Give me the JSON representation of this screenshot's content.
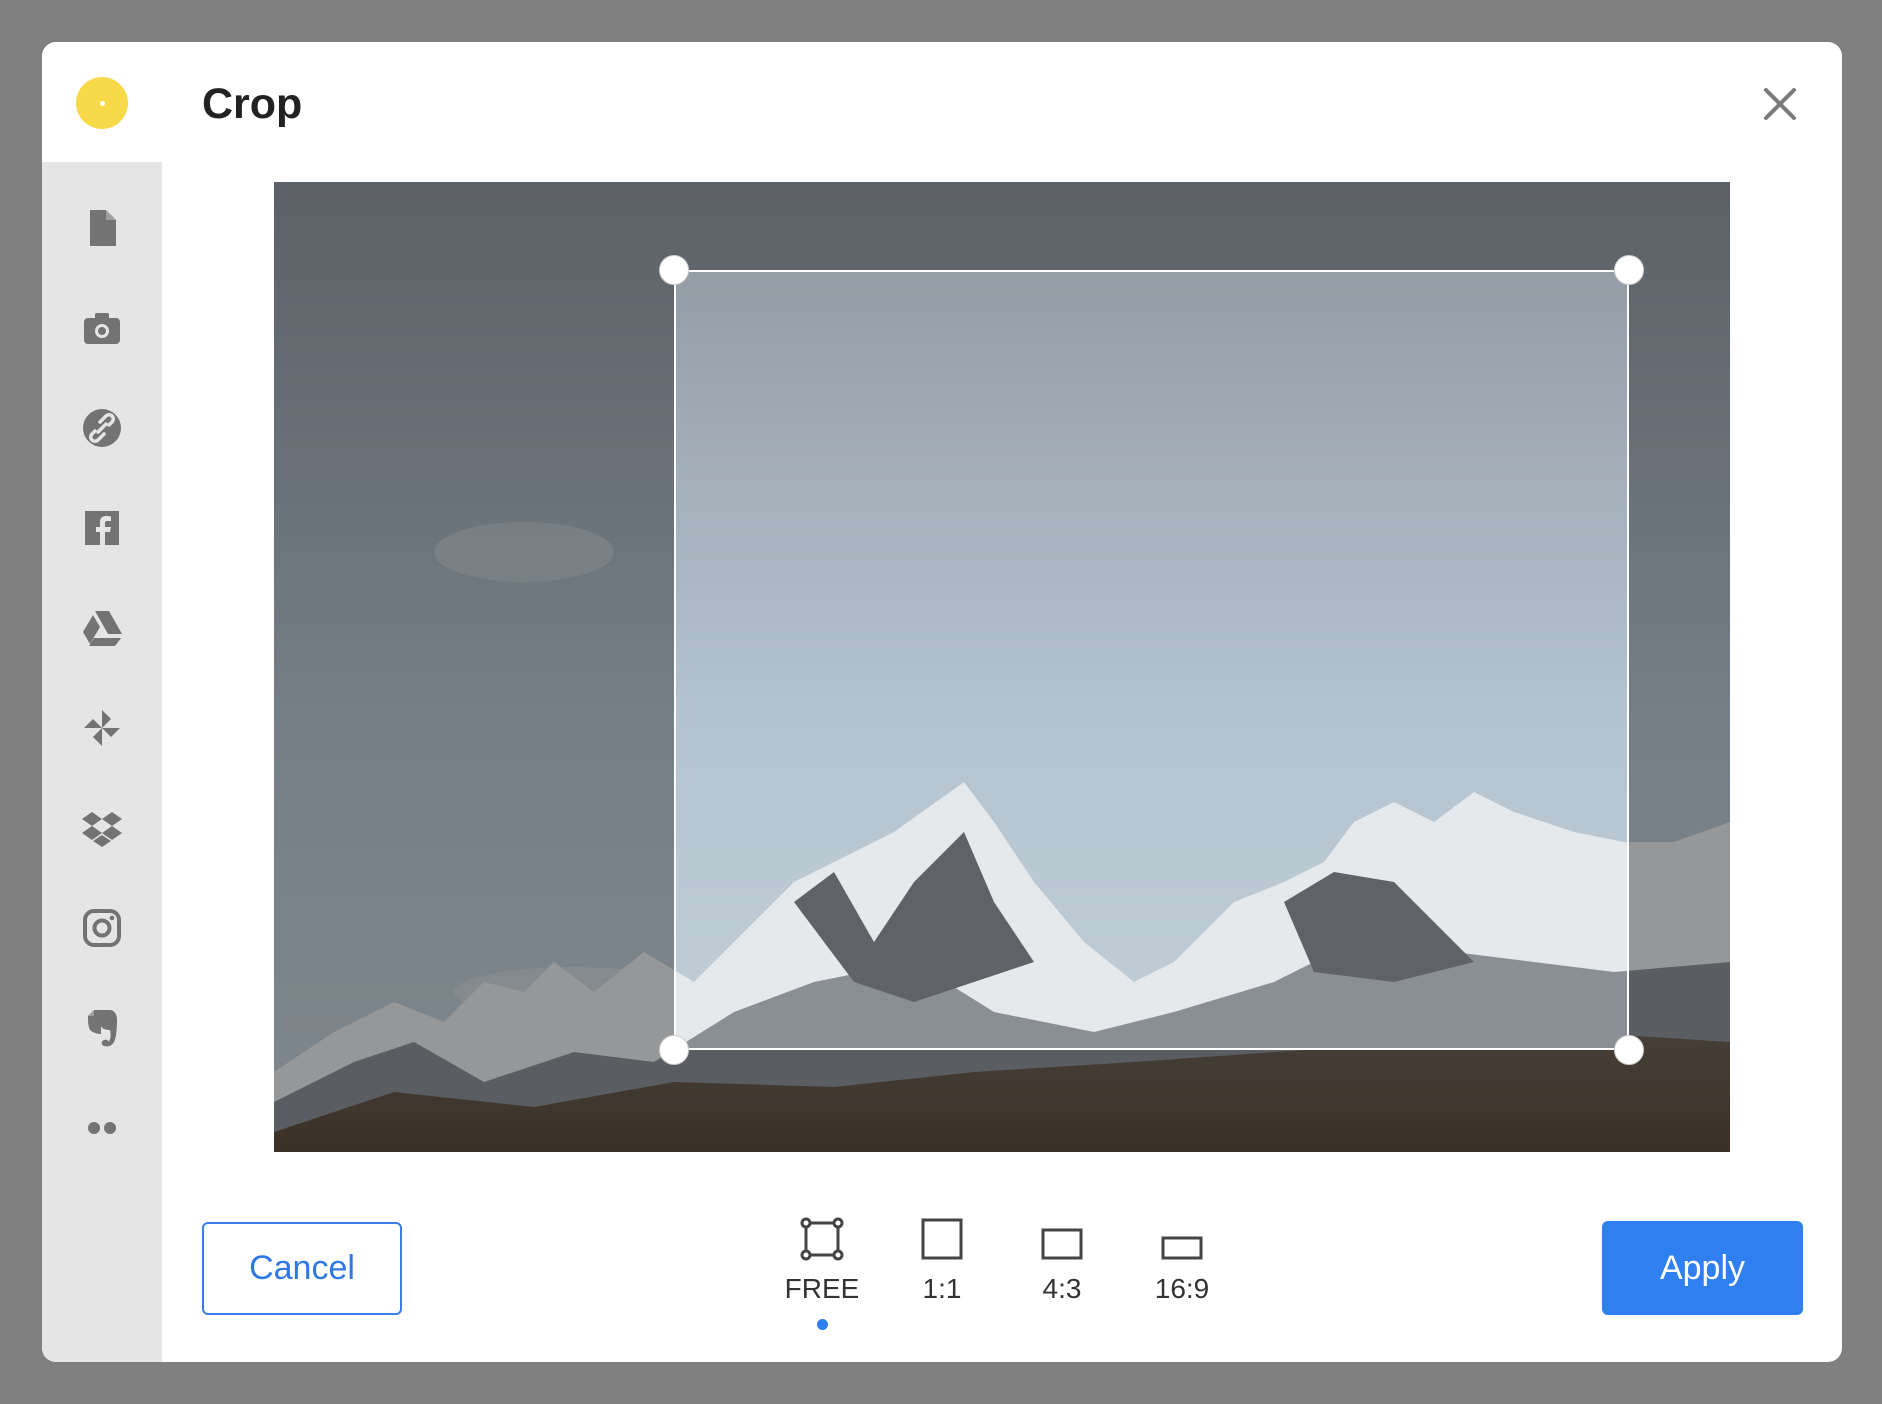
{
  "dialog": {
    "title": "Crop"
  },
  "sidebar": {
    "items": [
      {
        "name": "file-icon"
      },
      {
        "name": "camera-icon"
      },
      {
        "name": "link-icon"
      },
      {
        "name": "facebook-icon"
      },
      {
        "name": "google-drive-icon"
      },
      {
        "name": "google-photos-icon"
      },
      {
        "name": "dropbox-icon"
      },
      {
        "name": "instagram-icon"
      },
      {
        "name": "evernote-icon"
      },
      {
        "name": "more-icon"
      }
    ]
  },
  "ratios": {
    "free": "FREE",
    "square": "1:1",
    "four_three": "4:3",
    "sixteen_nine": "16:9",
    "selected": "FREE"
  },
  "buttons": {
    "cancel": "Cancel",
    "apply": "Apply"
  },
  "colors": {
    "accent": "#2f7ff0",
    "logo": "#f7d94a",
    "sidebar_bg": "#e5e5e5",
    "backdrop": "#808080"
  }
}
